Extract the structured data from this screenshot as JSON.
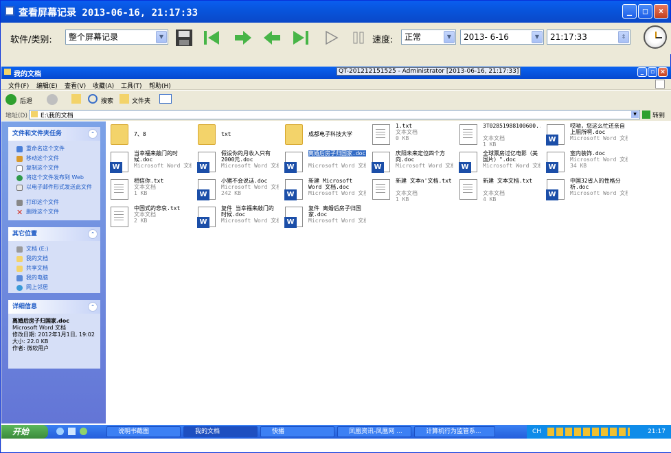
{
  "outer_window": {
    "title": "查看屏幕记录 2013-06-16, 21:17:33",
    "min": "_",
    "max": "□",
    "close": "×"
  },
  "toolbar": {
    "software_label": "软件/类别:",
    "category_value": "整个屏幕记录",
    "speed_label": "速度:",
    "speed_value": "正常",
    "date_value": "2013- 6-16",
    "time_value": "21:17:33"
  },
  "inner_window": {
    "title": "我的文档",
    "subtitle": "QT-201212151525 - Administrator [2013-06-16, 21:17:33]",
    "menu": [
      "文件(F)",
      "编辑(E)",
      "查看(V)",
      "收藏(A)",
      "工具(T)",
      "帮助(H)"
    ],
    "back_label": "后退",
    "search_label": "搜索",
    "folders_label": "文件夹",
    "address_label": "地址(D)",
    "address_value": "E:\\我的文档",
    "go_label": "转到"
  },
  "left_pane": {
    "tasks": {
      "title": "文件和文件夹任务",
      "items": [
        "重命名这个文件",
        "移动这个文件",
        "复制这个文件",
        "将这个文件发布到 Web",
        "以电子邮件形式发送此文件",
        "打印这个文件",
        "删除这个文件"
      ]
    },
    "places": {
      "title": "其它位置",
      "items": [
        "文档 (E:)",
        "我的文档",
        "共享文档",
        "我的电脑",
        "网上邻居"
      ]
    },
    "details": {
      "title": "详细信息",
      "name": "离婚后房子归国家.doc",
      "type": "Microsoft Word 文档",
      "modified": "修改日期: 2012年1月1日, 19:02",
      "size": "大小: 22.0 KB",
      "author": "作者: 微软用户"
    }
  },
  "files": [
    {
      "name": "7、8",
      "kind": "folder",
      "type": "",
      "size": ""
    },
    {
      "name": "txt",
      "kind": "folder",
      "type": "",
      "size": ""
    },
    {
      "name": "成都电子科技大学",
      "kind": "folder",
      "type": "",
      "size": ""
    },
    {
      "name": "1.txt",
      "kind": "txt",
      "type": "文本文档",
      "size": "0 KB"
    },
    {
      "name": "3T02851988100600...",
      "kind": "txt",
      "type": "文本文档",
      "size": "1 KB"
    },
    {
      "name": "哎呦，您这么忙还亲自上厕所啊.doc",
      "kind": "doc",
      "type": "Microsoft Word 文档",
      "size": ""
    },
    {
      "name": "当幸福来敲门的时候.doc",
      "kind": "doc",
      "type": "Microsoft Word 文档",
      "size": ""
    },
    {
      "name": "假设你的月收入只有2000元.doc",
      "kind": "doc",
      "type": "Microsoft Word 文档",
      "size": ""
    },
    {
      "name": "离婚后房子归国家.doc",
      "kind": "doc",
      "type": "Microsoft Word 文档",
      "size": "",
      "selected": true
    },
    {
      "name": "庆阳未来定位四个方向.doc",
      "kind": "doc",
      "type": "Microsoft Word 文档",
      "size": ""
    },
    {
      "name": "全球票房过亿电影（美国片）\".doc",
      "kind": "doc",
      "type": "Microsoft Word 文档",
      "size": ""
    },
    {
      "name": "室内装饰.doc",
      "kind": "doc",
      "type": "Microsoft Word 文档",
      "size": "34 KB"
    },
    {
      "name": "相信你.txt",
      "kind": "txt",
      "type": "文本文档",
      "size": "1 KB"
    },
    {
      "name": "小猪不会说话.doc",
      "kind": "doc",
      "type": "Microsoft Word 文档",
      "size": "242 KB"
    },
    {
      "name": "新建 Microsoft Word 文档.doc",
      "kind": "doc",
      "type": "Microsoft Word 文档",
      "size": ""
    },
    {
      "name": "新建 文本n'文档.txt",
      "kind": "txt",
      "type": "文本文档",
      "size": "1 KB"
    },
    {
      "name": "新建 文本文档.txt",
      "kind": "txt",
      "type": "文本文档",
      "size": "4 KB"
    },
    {
      "name": "中国32省人的性格分析.doc",
      "kind": "doc",
      "type": "Microsoft Word 文档",
      "size": ""
    },
    {
      "name": "中国式的悲哀.txt",
      "kind": "txt",
      "type": "文本文档",
      "size": "2 KB"
    },
    {
      "name": "复件 当幸福来敲门的时候.doc",
      "kind": "doc",
      "type": "Microsoft Word 文档",
      "size": ""
    },
    {
      "name": "复件 离婚后房子归国家.doc",
      "kind": "doc",
      "type": "Microsoft Word 文档",
      "size": ""
    }
  ],
  "taskbar": {
    "start": "开始",
    "tasks": [
      "说明书截图",
      "我的文档",
      "快播",
      "凤凰资讯-凤凰网 ...",
      "计算机行为监管系..."
    ],
    "tray_lang": "CH",
    "tray_time": "21:17"
  }
}
